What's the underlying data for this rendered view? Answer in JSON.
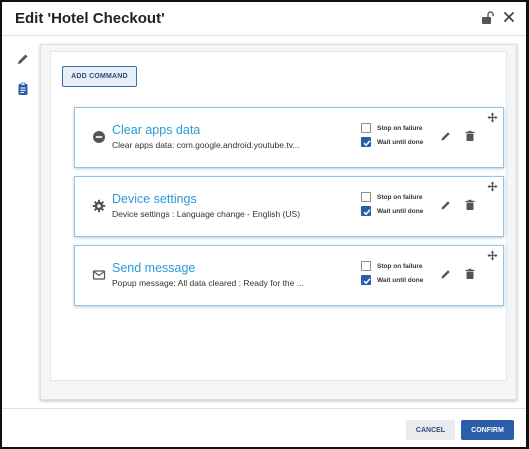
{
  "dialog": {
    "title": "Edit 'Hotel Checkout'"
  },
  "panel": {
    "add_command_label": "ADD COMMAND"
  },
  "commands": [
    {
      "icon": "minus-circle-icon",
      "title": "Clear apps data",
      "description": "Clear apps data: com.google.android.youtube.tv...",
      "stop_on_failure": {
        "label": "Stop on failure",
        "checked": false
      },
      "wait_until_done": {
        "label": "Wait until done",
        "checked": true
      }
    },
    {
      "icon": "gear-icon",
      "title": "Device settings",
      "description": "Device settings : Language change - English (US)",
      "stop_on_failure": {
        "label": "Stop on failure",
        "checked": false
      },
      "wait_until_done": {
        "label": "Wait until done",
        "checked": true
      }
    },
    {
      "icon": "envelope-icon",
      "title": "Send message",
      "description": "Popup message: All data cleared : Ready for the ...",
      "stop_on_failure": {
        "label": "Stop on failure",
        "checked": false
      },
      "wait_until_done": {
        "label": "Wait until done",
        "checked": true
      }
    }
  ],
  "footer": {
    "cancel_label": "CANCEL",
    "confirm_label": "CONFIRM"
  },
  "colors": {
    "accent": "#2a5ea8",
    "title_link": "#2d9ad8",
    "card_border": "#8ec7ee"
  }
}
